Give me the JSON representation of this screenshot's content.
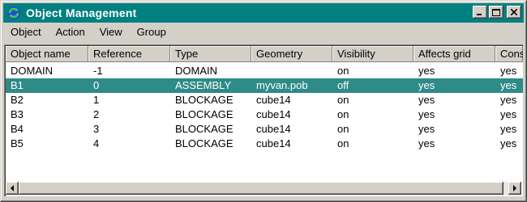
{
  "window": {
    "title": "Object Management"
  },
  "titlebar_buttons": {
    "minimize": "minimize",
    "maximize": "maximize",
    "close": "close"
  },
  "menu": [
    {
      "label": "Object"
    },
    {
      "label": "Action"
    },
    {
      "label": "View"
    },
    {
      "label": "Group"
    }
  ],
  "columns": [
    "Object name",
    "Reference",
    "Type",
    "Geometry",
    "Visibility",
    "Affects grid",
    "Cons"
  ],
  "rows": [
    {
      "name": "DOMAIN",
      "reference": "-1",
      "type": "DOMAIN",
      "geometry": "",
      "visibility": "on",
      "affects_grid": "yes",
      "cons": "yes"
    },
    {
      "name": "B1",
      "reference": "0",
      "type": "ASSEMBLY",
      "geometry": "myvan.pob",
      "visibility": "off",
      "affects_grid": "yes",
      "cons": "yes"
    },
    {
      "name": "B2",
      "reference": "1",
      "type": "BLOCKAGE",
      "geometry": "cube14",
      "visibility": "on",
      "affects_grid": "yes",
      "cons": "yes"
    },
    {
      "name": "B3",
      "reference": "2",
      "type": "BLOCKAGE",
      "geometry": "cube14",
      "visibility": "on",
      "affects_grid": "yes",
      "cons": "yes"
    },
    {
      "name": "B4",
      "reference": "3",
      "type": "BLOCKAGE",
      "geometry": "cube14",
      "visibility": "on",
      "affects_grid": "yes",
      "cons": "yes"
    },
    {
      "name": "B5",
      "reference": "4",
      "type": "BLOCKAGE",
      "geometry": "cube14",
      "visibility": "on",
      "affects_grid": "yes",
      "cons": "yes"
    }
  ],
  "colors": {
    "titlebar": "#008080",
    "selection": "#2e8b87",
    "chrome": "#d4d0c8"
  }
}
